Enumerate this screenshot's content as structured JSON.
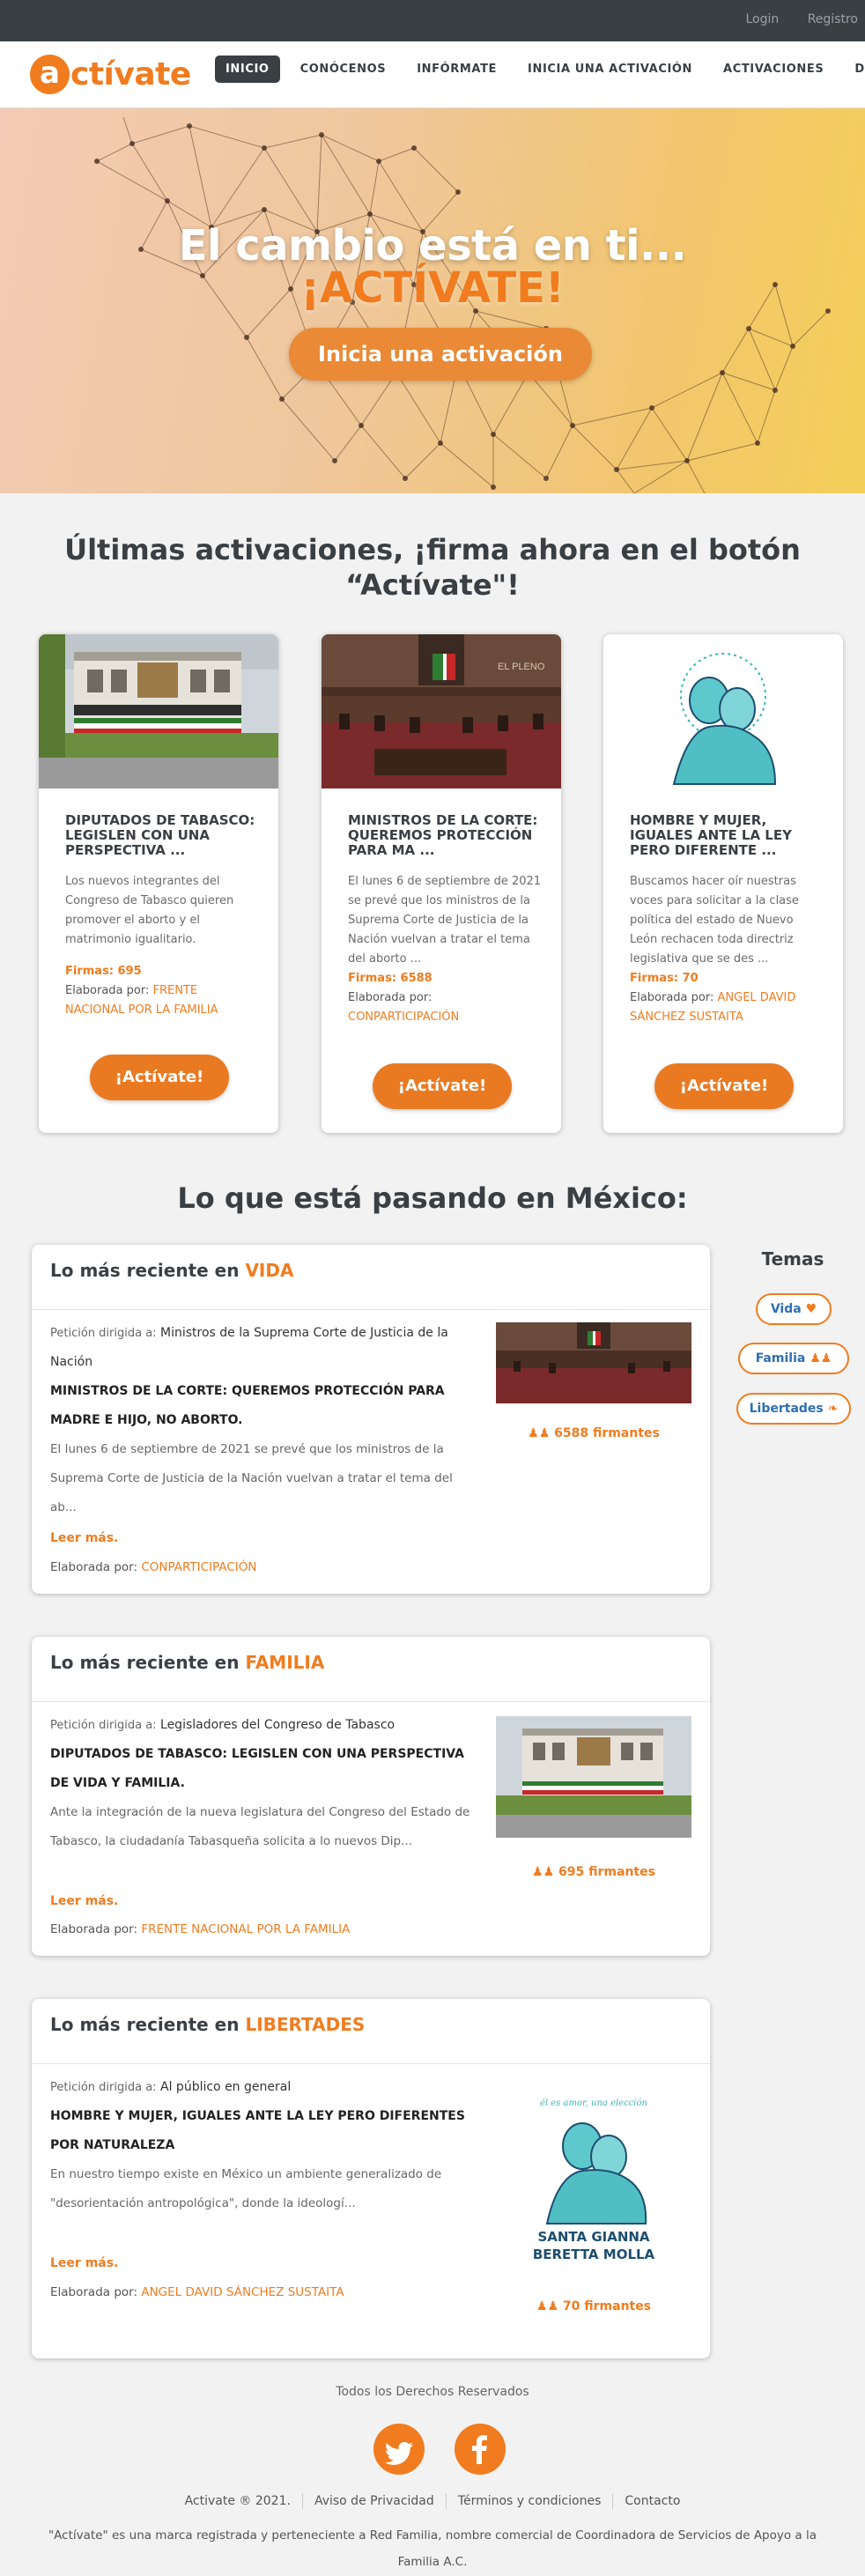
{
  "topbar": {
    "login": "Login",
    "register": "Registro"
  },
  "nav": {
    "logo_letter": "a",
    "logo_rest": "ctívate",
    "items": [
      "INICIO",
      "CONÓCENOS",
      "INFÓRMATE",
      "INICIA UNA ACTIVACIÓN",
      "ACTIVACIONES",
      "DONA"
    ],
    "active": "INICIO"
  },
  "hero": {
    "title": "El cambio está en ti...",
    "subtitle": "¡ACTÍVATE!",
    "button": "Inicia una activación"
  },
  "latest": {
    "heading_line1": "Últimas activaciones, ¡firma ahora en el botón",
    "heading_line2": "“Actívate\"!",
    "cards": [
      {
        "title": "DIPUTADOS DE TABASCO: LEGISLEN CON UNA PERSPECTIVA ...",
        "description": "Los nuevos integrantes del Congreso de Tabasco quieren promover el aborto y el matrimonio igualitario.",
        "signatures": "Firmas: 695",
        "by_label": "Elaborada por:",
        "by": "FRENTE NACIONAL POR LA FAMILIA",
        "button": "¡Actívate!",
        "image": "Congreso del Estado de Tabasco building"
      },
      {
        "title": "MINISTROS DE LA CORTE: QUEREMOS PROTECCIÓN PARA MA ...",
        "description": "El lunes 6 de septiembre de 2021 se prevé que los ministros de la Suprema Corte de Justicia de la Nación vuelvan a tratar el tema del aborto ...",
        "signatures": "Firmas: 6588",
        "by_label": "Elaborada por:",
        "by": "CONPARTICIPACIÓN",
        "button": "¡Actívate!",
        "image": "Supreme Court session hall"
      },
      {
        "title": "HOMBRE Y MUJER, IGUALES ANTE LA LEY PERO DIFERENTE ...",
        "description": "Buscamos hacer oír nuestras voces para solicitar a la clase política del estado de Nuevo León rechacen toda directriz legislativa que se des ...",
        "signatures": "Firmas: 70",
        "by_label": "Elaborada por:",
        "by": "ANGEL DAVID SÁNCHEZ SUSTAITA",
        "button": "¡Actívate!",
        "image": "Mother and child illustration"
      }
    ]
  },
  "mexico": {
    "heading": "Lo que está pasando en México:",
    "panels": [
      {
        "head_prefix": "Lo más reciente en",
        "category": "VIDA",
        "target_label": "Petición dirigida a:",
        "target": "Ministros de la Suprema Corte de Justicia de la Nación",
        "title": "MINISTROS DE LA CORTE: QUEREMOS PROTECCIÓN PARA MADRE E HIJO, NO ABORTO.",
        "description": "El lunes 6 de septiembre de 2021 se prevé que los ministros de la Suprema Corte de Justicia de la Nación vuelvan a tratar el tema del ab...",
        "more": "Leer más.",
        "by_label": "Elaborada por:",
        "by": "CONPARTICIPACIÓN",
        "signatures": "6588 firmantes"
      },
      {
        "head_prefix": "Lo más reciente en",
        "category": "FAMILIA",
        "target_label": "Petición dirigida a:",
        "target": "Legisladores del Congreso de Tabasco",
        "title": "DIPUTADOS DE TABASCO: LEGISLEN CON UNA PERSPECTIVA DE VIDA Y FAMILIA.",
        "description": "Ante la integración de la nueva legislatura del Congreso del Estado de Tabasco, la ciudadanía Tabasqueña solicita a lo nuevos Dip...",
        "more": "Leer más.",
        "by_label": "Elaborada por:",
        "by": "FRENTE NACIONAL POR LA FAMILIA",
        "signatures": "695 firmantes"
      },
      {
        "head_prefix": "Lo más reciente en",
        "category": "LIBERTADES",
        "target_label": "Petición dirigida a:",
        "target": "Al público en general",
        "title": "HOMBRE Y MUJER, IGUALES ANTE LA LEY PERO DIFERENTES POR NATURALEZA",
        "description": "En nuestro tiempo existe en México un ambiente generalizado de \"desorientación antropológica\", donde la ideologí...",
        "more": "Leer más.",
        "by_label": "Elaborada por:",
        "by": "ANGEL DAVID SÁNCHEZ SUSTAITA",
        "signatures": "70 firmantes"
      }
    ]
  },
  "temas": {
    "title": "Temas",
    "items": [
      "Vida",
      "Familia",
      "Libertades"
    ]
  },
  "illustration": {
    "top_text": "él es amor, una elección",
    "name_line1": "SANTA GIANNA",
    "name_line2": "BERETTA MOLLA"
  },
  "courtroom_sign": "EL PLENO",
  "footer": {
    "rights": "Todos los Derechos Reservados",
    "copyright": "Activate ® 2021.",
    "privacy": "Aviso de Privacidad",
    "terms": "Términos y condiciones",
    "contact": "Contacto",
    "note": "\"Actívate\" es una marca registrada y perteneciente a Red Familia, nombre comercial de Coordinadora de Servicios de Apoyo a la Familia A.C."
  },
  "colors": {
    "accent": "#f07c1f",
    "dark": "#3a3f44",
    "link_blue": "#2f6fb0"
  }
}
